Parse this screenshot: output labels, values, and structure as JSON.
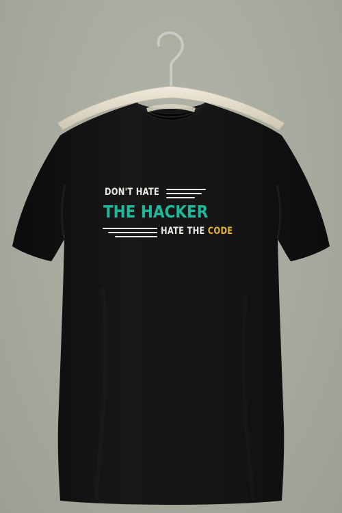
{
  "print": {
    "line1": "DON'T HATE",
    "line2": "THE HACKER",
    "line3_a": "HATE THE ",
    "line3_b": "CODE"
  },
  "colors": {
    "background": "#a8aca0",
    "shirt": "#141414",
    "hanger": "#e2dccd",
    "accent_green": "#21b79a",
    "accent_yellow": "#e9b431",
    "print_white": "#ece9e3"
  }
}
